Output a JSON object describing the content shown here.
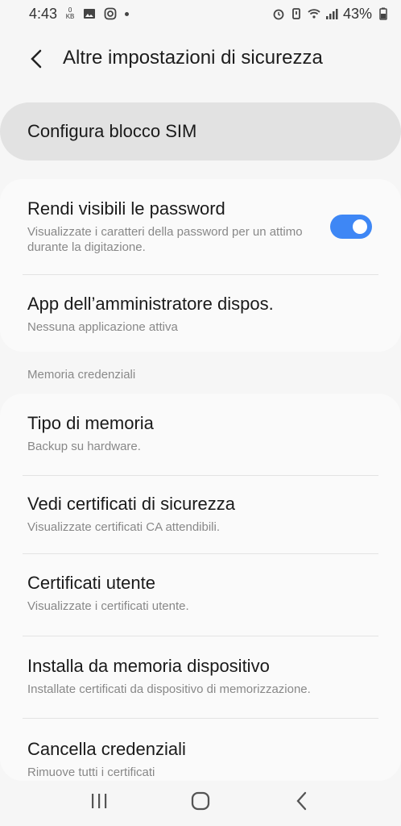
{
  "status_bar": {
    "time": "4:43",
    "data_rate_value": "0",
    "data_rate_unit": "KB",
    "battery": "43%"
  },
  "header": {
    "title": "Altre impostazioni di sicurezza"
  },
  "sim_lock": {
    "label": "Configura blocco SIM"
  },
  "general": {
    "items": [
      {
        "title": "Rendi visibili le password",
        "subtitle": "Visualizzate i caratteri della password per un attimo durante la digitazione.",
        "toggle_on": true
      },
      {
        "title": "App dell’amministratore dispos.",
        "subtitle": "Nessuna applicazione attiva"
      }
    ]
  },
  "credentials": {
    "section_label": "Memoria credenziali",
    "items": [
      {
        "title": "Tipo di memoria",
        "subtitle": "Backup su hardware."
      },
      {
        "title": "Vedi certificati di sicurezza",
        "subtitle": "Visualizzate certificati CA attendibili."
      },
      {
        "title": "Certificati utente",
        "subtitle": "Visualizzate i certificati utente."
      },
      {
        "title": "Installa da memoria dispositivo",
        "subtitle": "Installate certificati da dispositivo di memorizzazione."
      },
      {
        "title": "Cancella credenziali",
        "subtitle": "Rimuove tutti i certificati"
      }
    ]
  },
  "colors": {
    "accent": "#3e87f5",
    "background": "#f6f6f6",
    "card": "#fafafa",
    "pressed_row": "#e2e2e2"
  }
}
